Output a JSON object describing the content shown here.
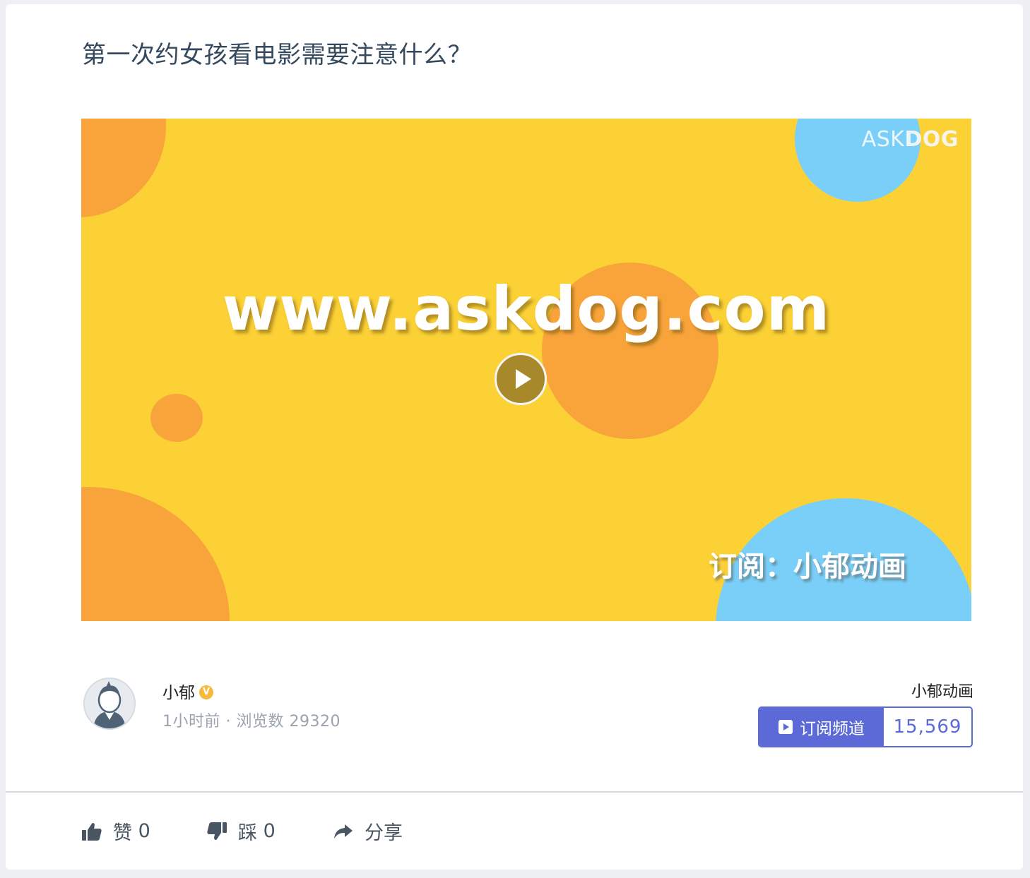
{
  "post": {
    "title": "第一次约女孩看电影需要注意什么？"
  },
  "video": {
    "brand_light": "ASK",
    "brand_bold": "DOG",
    "overlay_url": "www.askdog.com",
    "overlay_subscribe": "订阅：小郁动画",
    "colors": {
      "background": "#fbd136",
      "orange": "#f9a43b",
      "blue": "#7acff8"
    }
  },
  "author": {
    "name": "小郁",
    "badge": "V",
    "time": "1小时前",
    "separator": "·",
    "views_label": "浏览数",
    "views": "29320"
  },
  "channel": {
    "name": "小郁动画",
    "subscribe_label": "订阅频道",
    "subscriber_count": "15,569",
    "accent": "#5b6ad6"
  },
  "actions": {
    "like_label": "赞",
    "like_count": "0",
    "dislike_label": "踩",
    "dislike_count": "0",
    "share_label": "分享"
  }
}
